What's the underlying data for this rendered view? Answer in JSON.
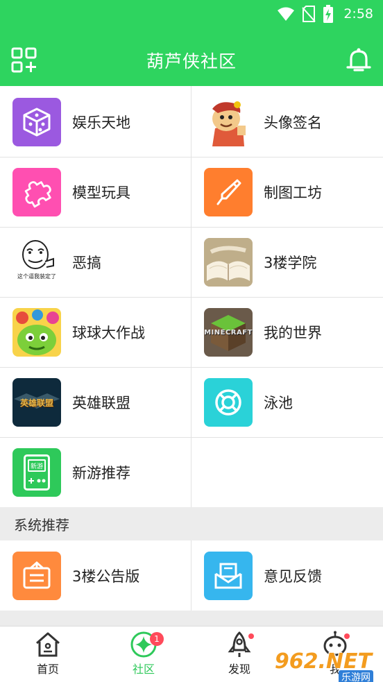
{
  "status_bar": {
    "time": "2:58",
    "icons": [
      "wifi-icon",
      "no-sim-icon",
      "battery-charging-icon"
    ]
  },
  "header": {
    "title": "葫芦侠社区",
    "left_icon": "grid-add-icon",
    "right_icon": "bell-icon"
  },
  "grid": {
    "items": [
      {
        "label": "娱乐天地",
        "icon": "dice-icon",
        "color": "#9b59e0"
      },
      {
        "label": "头像签名",
        "icon": "cartoon-avatar-icon"
      },
      {
        "label": "模型玩具",
        "icon": "puzzle-icon",
        "color": "#ff4fb1"
      },
      {
        "label": "制图工坊",
        "icon": "brush-icon",
        "color": "#ff7e2e"
      },
      {
        "label": "恶搞",
        "icon": "meme-face-icon",
        "caption": "这个逼我装定了"
      },
      {
        "label": "3楼学院",
        "icon": "open-book-icon"
      },
      {
        "label": "球球大作战",
        "icon": "blob-monster-icon"
      },
      {
        "label": "我的世界",
        "icon": "minecraft-logo-icon",
        "logo_text": "MINECRAFT"
      },
      {
        "label": "英雄联盟",
        "icon": "lol-logo-icon",
        "logo_text": "英雄联盟"
      },
      {
        "label": "泳池",
        "icon": "lifebuoy-icon",
        "color": "#2ad2d8"
      },
      {
        "label": "新游推荐",
        "icon": "handheld-console-icon",
        "color": "#2ec95a",
        "console_text": "新游"
      }
    ]
  },
  "system_section": {
    "title": "系统推荐",
    "items": [
      {
        "label": "3楼公告版",
        "icon": "notice-board-icon",
        "color": "#ff8a3d"
      },
      {
        "label": "意见反馈",
        "icon": "envelope-icon",
        "color": "#36b6ee"
      }
    ]
  },
  "bottom_nav": {
    "items": [
      {
        "label": "首页",
        "icon": "home-icon"
      },
      {
        "label": "社区",
        "icon": "sparkle-icon",
        "badge": "1",
        "active": true
      },
      {
        "label": "发现",
        "icon": "rocket-icon"
      },
      {
        "label": "我",
        "icon": "alien-avatar-icon"
      }
    ]
  },
  "watermark": {
    "text": "962.NET",
    "sub": "乐游网"
  },
  "colors": {
    "brand_green": "#2ed45f",
    "badge_red": "#ff4a5a"
  }
}
